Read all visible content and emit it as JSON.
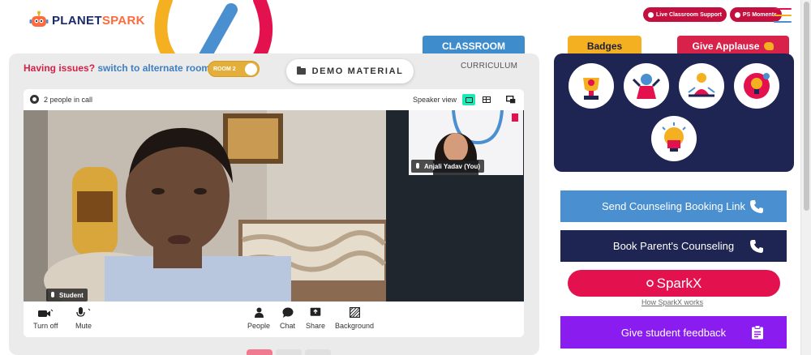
{
  "header": {
    "logo_text_1": "PLANET",
    "logo_text_2": "SPARK",
    "pills": [
      "Live Classroom Support",
      "PS Moments"
    ]
  },
  "tabs": {
    "classroom": "CLASSROOM",
    "curriculum": "CURRICULUM"
  },
  "issue": {
    "question": "Having issues?",
    "action": "switch to alternate room",
    "room_toggle": "ROOM 2"
  },
  "demo_button": "DEMO MATERIAL",
  "call": {
    "people_count": "2 people in call",
    "view_label": "Speaker view",
    "student_name": "Student",
    "teacher_name": "Anjali Yadav (You)",
    "controls": {
      "turn_off": "Turn off",
      "mute": "Mute",
      "people": "People",
      "chat": "Chat",
      "share": "Share",
      "background": "Background"
    }
  },
  "right": {
    "badges_tab": "Badges",
    "applause_tab": "Give Applause",
    "buttons": {
      "counseling_link": "Send Counseling Booking Link",
      "parent_counseling": "Book Parent's Counseling",
      "sparkx": "SparkX",
      "sparkx_link": "How SparkX works",
      "feedback": "Give student feedback"
    }
  },
  "colors": {
    "primary_blue": "#4a8fd0",
    "navy": "#1e2552",
    "magenta": "#e3124f",
    "purple": "#8a1cf0",
    "yellow": "#f4b021"
  },
  "icons": [
    "gear-icon",
    "phone-icon",
    "clipboard-icon",
    "camera-icon",
    "mic-icon",
    "people-icon",
    "chat-icon",
    "share-icon",
    "background-icon"
  ]
}
